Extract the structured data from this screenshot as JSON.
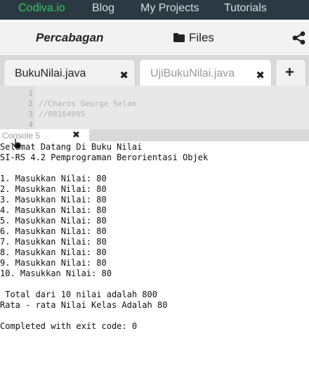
{
  "nav": {
    "brand": "Codiva.io",
    "links": [
      "Blog",
      "My Projects",
      "Tutorials"
    ]
  },
  "project": {
    "title": "Percabagan",
    "files_label": "Files"
  },
  "tabs": [
    {
      "label": "BukuNilai.java",
      "active": true
    },
    {
      "label": "UjiBukuNilai.java",
      "active": false
    }
  ],
  "editor": {
    "lines": [
      {
        "n": "1",
        "text": ""
      },
      {
        "n": "2",
        "text": "//Charos George Selan"
      },
      {
        "n": "3",
        "text": "//08164095"
      },
      {
        "n": "4",
        "text": ""
      }
    ]
  },
  "console": {
    "tab_label": "Console 5",
    "output": [
      "Selamat Datang Di Buku Nilai",
      "SI-RS 4.2 Pemprograman Berorientasi Objek",
      "",
      "1. Masukkan Nilai: 80",
      "2. Masukkan Nilai: 80",
      "3. Masukkan Nilai: 80",
      "4. Masukkan Nilai: 80",
      "5. Masukkan Nilai: 80",
      "6. Masukkan Nilai: 80",
      "7. Masukkan Nilai: 80",
      "8. Masukkan Nilai: 80",
      "9. Masukkan Nilai: 80",
      "10. Masukkan Nilai: 80",
      "",
      " Total dari 10 nilai adalah 800",
      "Rata - rata Nilai Kelas Adalah 80",
      "",
      "Completed with exit code: 0"
    ]
  },
  "colors": {
    "nav_bg": "#2b3a42",
    "brand": "#34c759"
  }
}
